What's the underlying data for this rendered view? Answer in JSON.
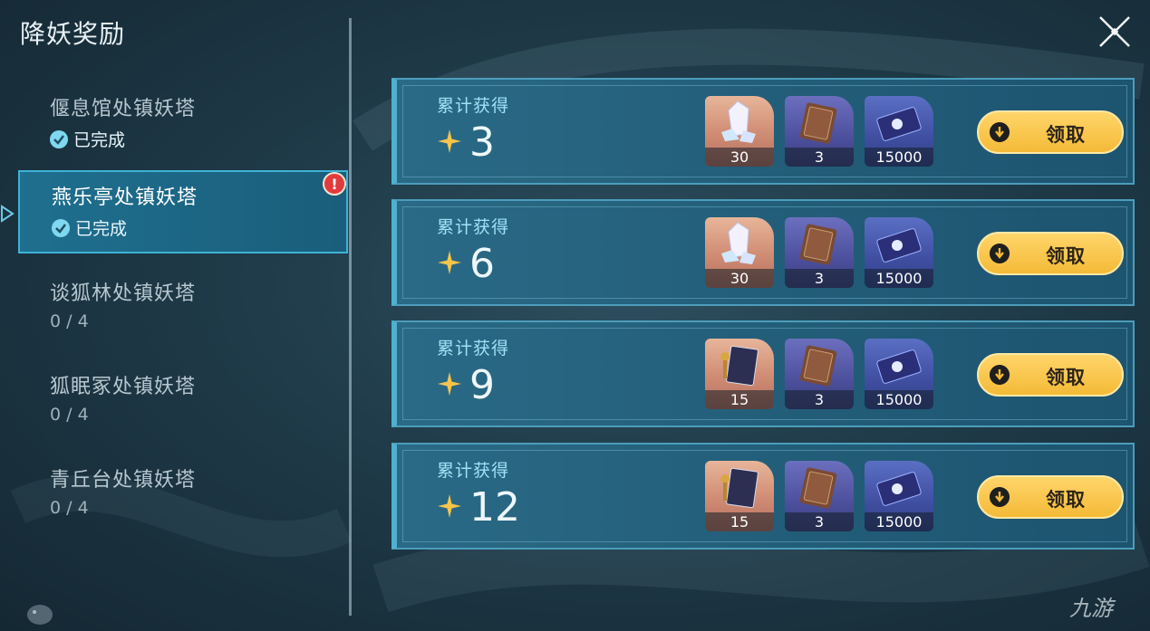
{
  "title": "降妖奖励",
  "sidebar": {
    "items": [
      {
        "name": "偃息馆处镇妖塔",
        "status": "已完成",
        "done": true,
        "active": false
      },
      {
        "name": "燕乐亭处镇妖塔",
        "status": "已完成",
        "done": true,
        "active": true,
        "alert": "!"
      },
      {
        "name": "谈狐林处镇妖塔",
        "status": "0 / 4",
        "done": false,
        "active": false
      },
      {
        "name": "狐眠冢处镇妖塔",
        "status": "0 / 4",
        "done": false,
        "active": false
      },
      {
        "name": "青丘台处镇妖塔",
        "status": "0 / 4",
        "done": false,
        "active": false
      }
    ]
  },
  "rewards": [
    {
      "label": "累计获得",
      "count": "3",
      "items": [
        {
          "icon": "crystal-icon",
          "qty": "30",
          "bg": "gold"
        },
        {
          "icon": "book-icon",
          "qty": "3",
          "bg": "purple"
        },
        {
          "icon": "ticket-icon",
          "qty": "15000",
          "bg": "blue"
        }
      ],
      "claim": "领取"
    },
    {
      "label": "累计获得",
      "count": "6",
      "items": [
        {
          "icon": "crystal-icon",
          "qty": "30",
          "bg": "gold"
        },
        {
          "icon": "book-icon",
          "qty": "3",
          "bg": "purple"
        },
        {
          "icon": "ticket-icon",
          "qty": "15000",
          "bg": "blue"
        }
      ],
      "claim": "领取"
    },
    {
      "label": "累计获得",
      "count": "9",
      "items": [
        {
          "icon": "spellbook-icon",
          "qty": "15",
          "bg": "gold"
        },
        {
          "icon": "book-icon",
          "qty": "3",
          "bg": "purple"
        },
        {
          "icon": "ticket-icon",
          "qty": "15000",
          "bg": "blue"
        }
      ],
      "claim": "领取"
    },
    {
      "label": "累计获得",
      "count": "12",
      "items": [
        {
          "icon": "spellbook-icon",
          "qty": "15",
          "bg": "gold"
        },
        {
          "icon": "book-icon",
          "qty": "3",
          "bg": "purple"
        },
        {
          "icon": "ticket-icon",
          "qty": "15000",
          "bg": "blue"
        }
      ],
      "claim": "领取"
    }
  ],
  "colors": {
    "accent": "#3fb2d6",
    "claim": "#f4ba37",
    "alert": "#e23b3b"
  },
  "watermark": "九游"
}
